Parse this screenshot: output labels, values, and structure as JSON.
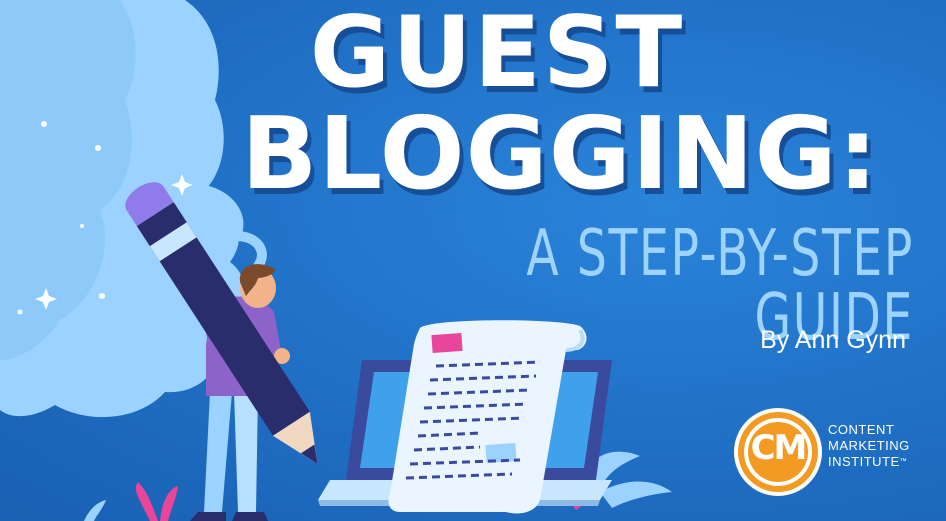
{
  "title": {
    "line1": "GUEST",
    "line2": "BLOGGING:",
    "subtitle": "A STEP-BY-STEP GUIDE"
  },
  "byline": "By Ann Gynn",
  "logo": {
    "mark": "CM",
    "lines": [
      "CONTENT",
      "MARKETING",
      "INSTITUTE"
    ],
    "trademark": "™",
    "colors": {
      "ring": "#f39a22",
      "inner": "#ffffff"
    }
  },
  "colors": {
    "background": "#1f6fc4",
    "cloud": "#9bd2ff",
    "subtitle": "#9fd3ff",
    "pencil": "#2a2d6b",
    "eraser": "#8f7bea",
    "shirt": "#8e63c9",
    "laptop": "#3a4b9e"
  },
  "icons": [
    "cloud-illustration",
    "pencil-illustration",
    "person-illustration",
    "laptop-illustration",
    "paper-scroll-illustration",
    "sparkle-icon",
    "plant-icon"
  ]
}
